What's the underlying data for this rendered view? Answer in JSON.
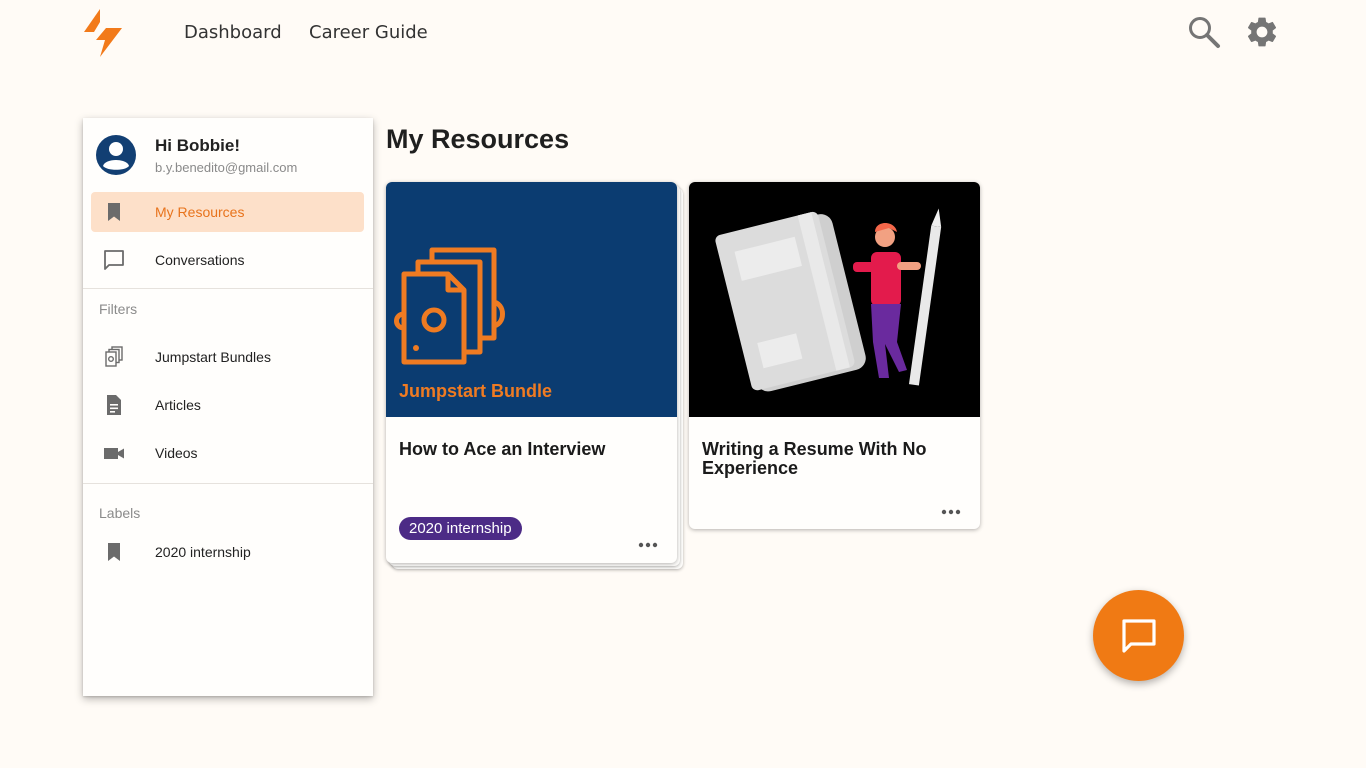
{
  "nav": {
    "links": [
      "Dashboard",
      "Career Guide"
    ],
    "icons": [
      "search-icon",
      "settings-gear-icon"
    ],
    "brand_color": "#f27a1a"
  },
  "sidebar": {
    "greeting": "Hi Bobbie!",
    "email": "b.y.benedito@gmail.com",
    "items": [
      {
        "label": "My Resources",
        "icon": "bookmark-icon",
        "active": true
      },
      {
        "label": "Conversations",
        "icon": "chat-icon",
        "active": false
      }
    ],
    "filters_title": "Filters",
    "filters": [
      {
        "label": "Jumpstart Bundles",
        "icon": "bundle-icon"
      },
      {
        "label": "Articles",
        "icon": "document-icon"
      },
      {
        "label": "Videos",
        "icon": "video-camera-icon"
      }
    ],
    "labels_title": "Labels",
    "labels": [
      {
        "label": "2020 internship",
        "icon": "bookmark-icon"
      }
    ]
  },
  "main": {
    "title": "My Resources",
    "cards": [
      {
        "media_text": "Jumpstart Bundle",
        "title": "How to Ace an Interview",
        "tag": "2020 internship",
        "media_color": "#0b3c71"
      },
      {
        "title": "Writing a Resume With No Experience",
        "media_color": "#000000"
      }
    ]
  },
  "fab": {
    "icon": "chat-icon",
    "color": "#f07a14"
  },
  "colors": {
    "accent": "#e8731c",
    "active_bg": "#fde0c9",
    "tag_bg": "#4c2b86",
    "avatar": "#123f73"
  }
}
